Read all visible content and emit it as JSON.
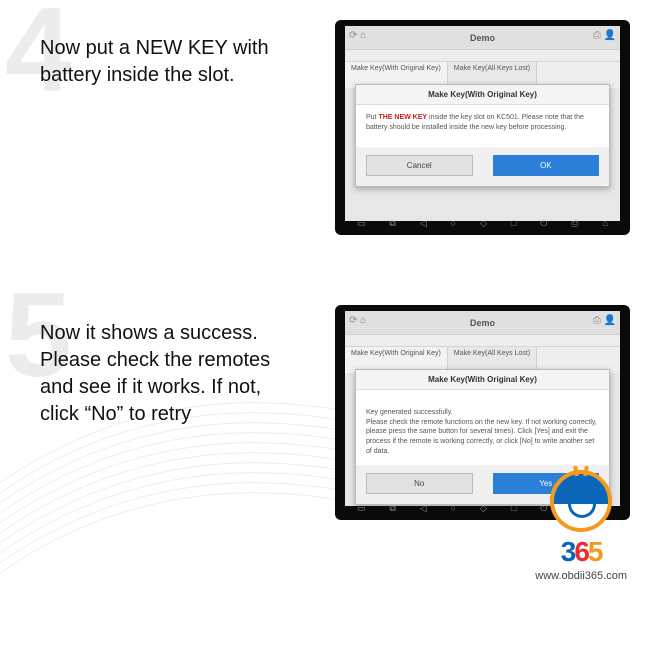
{
  "steps": [
    {
      "num": "4",
      "text": "Now put a NEW KEY with battery inside the slot.",
      "tablet": {
        "header_title": "Demo",
        "subheader": "",
        "tab1": "Make Key(With Original Key)",
        "tab2": "Make Key(All Keys Lost)",
        "dialog_title": "Make Key(With Original Key)",
        "dialog_pre": "Put ",
        "dialog_hl": "THE NEW KEY",
        "dialog_post": " inside the key slot on KC501. Please note that the battery should be installed inside the new key before processing.",
        "btn_left": "Cancel",
        "btn_right": "OK"
      }
    },
    {
      "num": "5",
      "text": "Now it shows a success. Please check the remotes and see if it works. If not, click “No” to retry",
      "tablet": {
        "header_title": "Demo",
        "subheader": "",
        "tab1": "Make Key(With Original Key)",
        "tab2": "Make Key(All Keys Lost)",
        "dialog_title": "Make Key(With Original Key)",
        "dialog_pre": "",
        "dialog_hl": "",
        "dialog_post": "Key generated successfully.\nPlease check the remote functions on the new key. If not working correctly, please press the same button for several times). Click [Yes] and exit the process if the remote is working correctly, or click [No] to write another set of data.",
        "btn_left": "No",
        "btn_right": "Yes"
      }
    }
  ],
  "logo": {
    "d0": "3",
    "d1": "6",
    "d2": "5",
    "url": "www.obdii365.com"
  },
  "nav_icons": [
    "▭",
    "⧉",
    "◁",
    "○",
    "◇",
    "□",
    "⏻",
    "⎙",
    "⌂"
  ]
}
